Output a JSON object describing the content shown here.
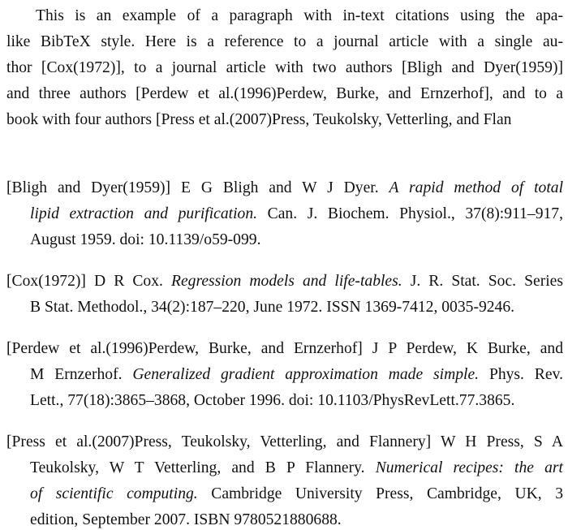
{
  "paragraph": {
    "lines": [
      "This is an example of a paragraph with in-text citations using the apa-",
      "like BibTeX style.  Here is a reference to a journal article with a single au-",
      "thor [Cox(1972)], to a journal article with two authors [Bligh and Dyer(1959)]",
      "and three authors [Perdew et al.(1996)Perdew, Burke, and Ernzerhof], and to a",
      "book with four authors [Press et al.(2007)Press, Teukolsky, Vetterling, and Flan"
    ]
  },
  "references": [
    {
      "label": "[Bligh and Dyer(1959)]",
      "line1_authors": "E G Bligh and W J Dyer.",
      "line1_title": "A rapid method of total",
      "line2_title": "lipid extraction and purification.",
      "line2_rest": "Can. J. Biochem. Physiol., 37(8):911–917,",
      "line3": "August 1959. doi: 10.1139/o59-099."
    },
    {
      "label": "[Cox(1972)]",
      "line1_authors": "D R Cox.",
      "line1_title": "Regression models and life-tables.",
      "line1_rest": "J. R. Stat. Soc. Series",
      "line2": "B Stat. Methodol., 34(2):187–220, June 1972. ISSN 1369-7412, 0035-9246."
    },
    {
      "label": "[Perdew et al.(1996)Perdew, Burke, and Ernzerhof]",
      "line1_authors": "J P Perdew, K Burke, and",
      "line2_authors": "M Ernzerhof.",
      "line2_title": "Generalized gradient approximation made simple.",
      "line2_rest": "Phys. Rev.",
      "line3": "Lett., 77(18):3865–3868, October 1996. doi: 10.1103/PhysRevLett.77.3865."
    },
    {
      "label": "[Press et al.(2007)Press, Teukolsky, Vetterling, and Flannery]",
      "line1_authors": "W H Press, S A",
      "line2_authors": "Teukolsky, W T Vetterling, and B P Flannery.",
      "line2_title": "Numerical recipes: the art",
      "line3_title": "of scientific computing.",
      "line3_rest": "Cambridge University Press, Cambridge, UK, 3",
      "line4": "edition, September 2007. ISBN 9780521880688."
    }
  ]
}
